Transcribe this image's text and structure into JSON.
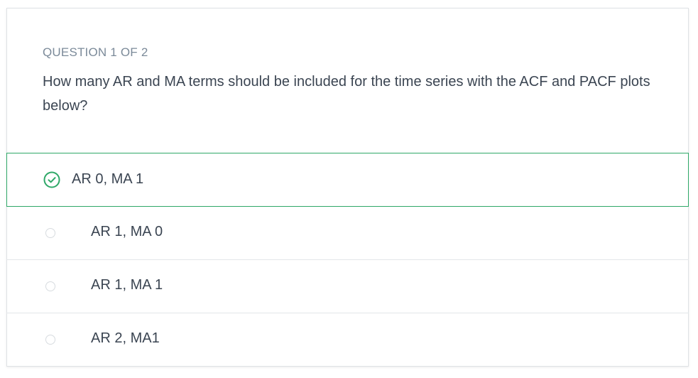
{
  "quiz": {
    "header": "QUESTION 1 OF 2",
    "question": "How many AR and MA terms should be included for the time series with the ACF and PACF plots below?",
    "answers": [
      {
        "label": "AR 0, MA 1",
        "selected": true
      },
      {
        "label": "AR 1, MA 0",
        "selected": false
      },
      {
        "label": "AR 1, MA 1",
        "selected": false
      },
      {
        "label": "AR 2, MA1",
        "selected": false
      }
    ]
  },
  "colors": {
    "correct": "#2fa868",
    "header_text": "#7b8a99",
    "body_text": "#3b4552"
  },
  "icons": {
    "selected": "check-circle-icon",
    "unselected": "radio-circle-icon"
  }
}
